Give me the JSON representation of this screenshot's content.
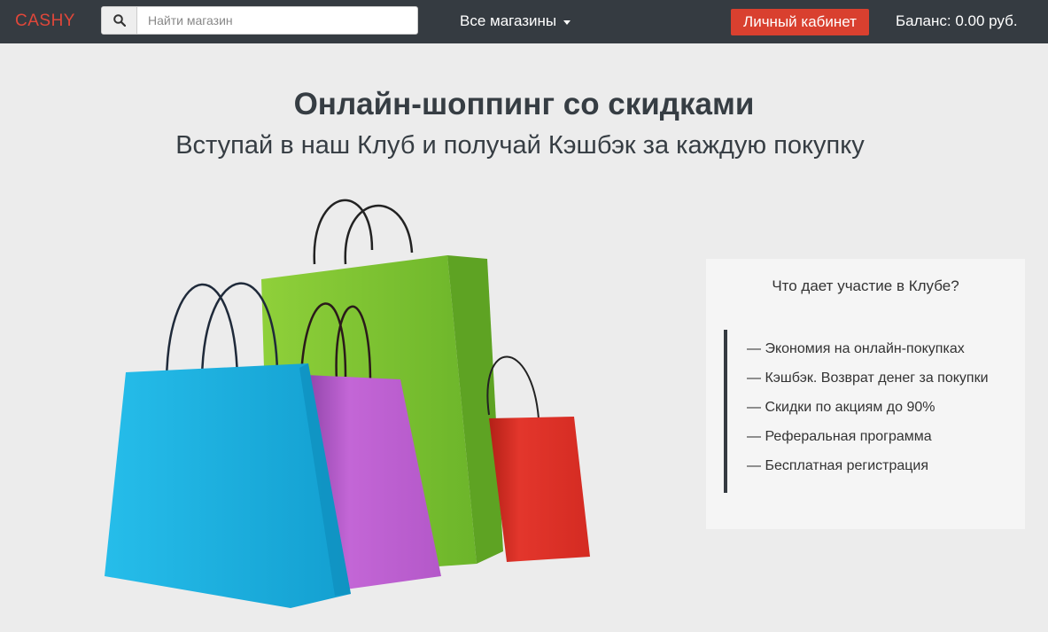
{
  "header": {
    "logo": "CASHY",
    "search_placeholder": "Найти магазин",
    "stores_label": "Все магазины",
    "cabinet_label": "Личный кабинет",
    "balance": "Баланс: 0.00 руб."
  },
  "hero": {
    "title": "Онлайн-шоппинг со скидками",
    "subtitle": "Вступай в наш Клуб и получай Кэшбэк за каждую покупку"
  },
  "club": {
    "title": "Что дает участие в Клубе?",
    "benefits": [
      "— Экономия на онлайн-покупках",
      "— Кэшбэк. Возврат денег за покупки",
      "— Скидки по акциям до 90%",
      "— Реферальная программа",
      "— Бесплатная регистрация"
    ]
  },
  "colors": {
    "header_bg": "#353b41",
    "logo": "#e0473a",
    "cabinet_button": "#d9402f",
    "bag_blue": "#1ab2e0",
    "bag_green": "#86c72e",
    "bag_purple": "#b35ac9",
    "bag_red": "#de3029"
  },
  "icons": {
    "search": "search-icon",
    "stores_dropdown": "caret-down-icon"
  }
}
